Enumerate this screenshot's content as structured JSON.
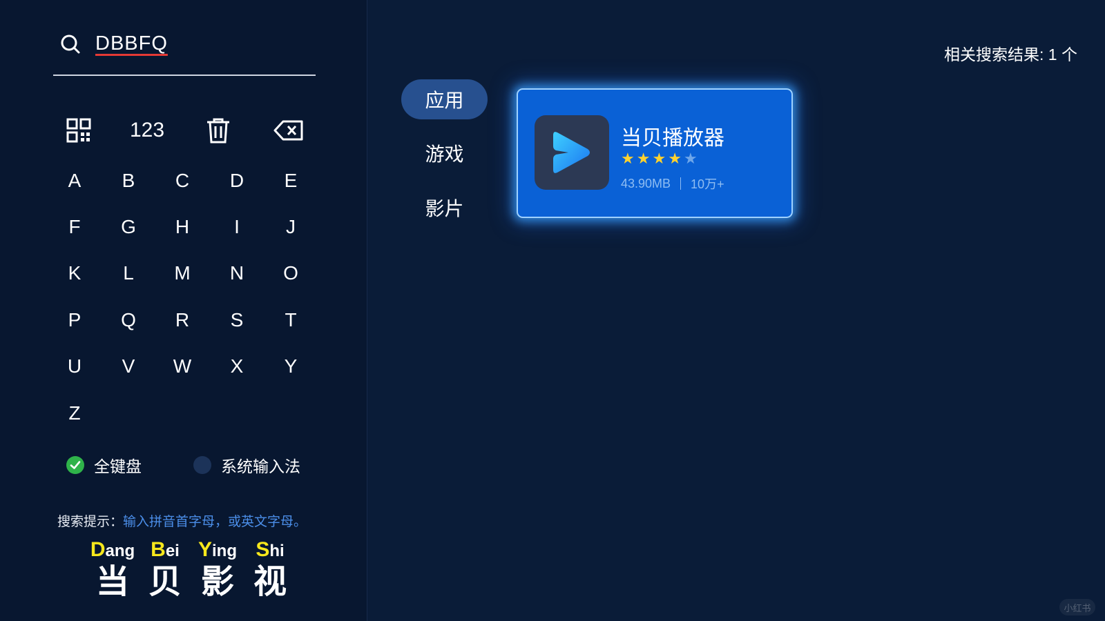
{
  "search": {
    "query": "DBBFQ"
  },
  "tools": {
    "qr_icon": "qr-code-icon",
    "numeric_label": "123",
    "clear_icon": "trash-icon",
    "backspace_icon": "backspace-icon"
  },
  "keyboard": {
    "keys": [
      "A",
      "B",
      "C",
      "D",
      "E",
      "F",
      "G",
      "H",
      "I",
      "J",
      "K",
      "L",
      "M",
      "N",
      "O",
      "P",
      "Q",
      "R",
      "S",
      "T",
      "U",
      "V",
      "W",
      "X",
      "Y",
      "Z"
    ]
  },
  "input_modes": [
    {
      "label": "全键盘",
      "selected": true
    },
    {
      "label": "系统输入法",
      "selected": false
    }
  ],
  "hint": {
    "label": "搜索提示：",
    "text": "输入拼音首字母，或英文字母。"
  },
  "pinyin_guide": [
    {
      "initial": "D",
      "rest": "ang",
      "hanzi": "当"
    },
    {
      "initial": "B",
      "rest": "ei",
      "hanzi": "贝"
    },
    {
      "initial": "Y",
      "rest": "ing",
      "hanzi": "影"
    },
    {
      "initial": "S",
      "rest": "hi",
      "hanzi": "视"
    }
  ],
  "categories": [
    {
      "label": "应用",
      "active": true
    },
    {
      "label": "游戏",
      "active": false
    },
    {
      "label": "影片",
      "active": false
    }
  ],
  "results": {
    "count_text": "相关搜索结果: 1 个",
    "items": [
      {
        "name": "当贝播放器",
        "rating": 4,
        "rating_max": 5,
        "size": "43.90MB",
        "downloads": "10万+"
      }
    ]
  },
  "watermark": "小红书",
  "colors": {
    "accent_card": "#0a61d6",
    "active_tab": "#27508f",
    "selected_radio": "#2fb34a",
    "hint_text": "#4b8ee8",
    "pinyin_initial": "#f7e81c",
    "star": "#ffd22e"
  }
}
